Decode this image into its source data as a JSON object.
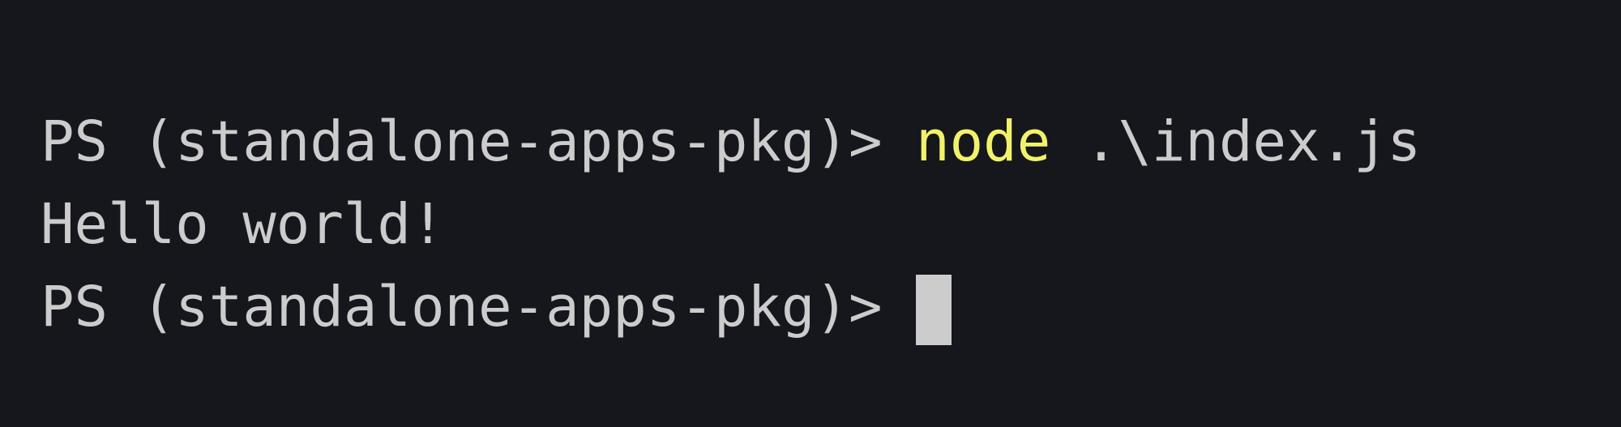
{
  "terminal": {
    "colors": {
      "background": "#16171c",
      "foreground": "#cccccc",
      "command": "#f1f26b",
      "cursor": "#cccccc"
    },
    "lines": [
      {
        "prompt": "PS (standalone-apps-pkg)> ",
        "command": "node",
        "args": " .\\index.js"
      },
      {
        "output": "Hello world!"
      },
      {
        "prompt": "PS (standalone-apps-pkg)> "
      }
    ]
  }
}
